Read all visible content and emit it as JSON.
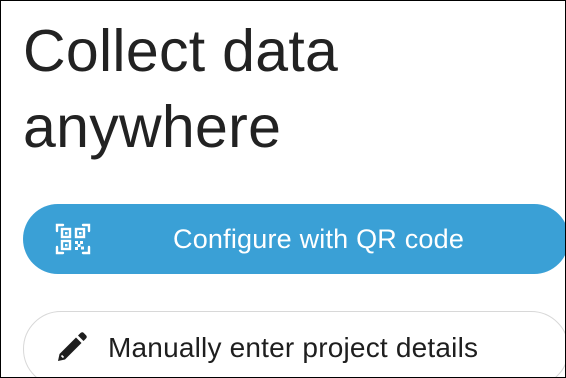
{
  "heading": {
    "line1": "Collect data",
    "line2": "anywhere"
  },
  "primary_action": {
    "label": "Configure with QR code",
    "icon": "qr-code-icon",
    "background_color": "#3aa0d6",
    "text_color": "#ffffff"
  },
  "secondary_action": {
    "label": "Manually enter project details",
    "icon": "pencil-icon",
    "border_color": "#d8d8d8",
    "text_color": "#1e1e1e"
  }
}
